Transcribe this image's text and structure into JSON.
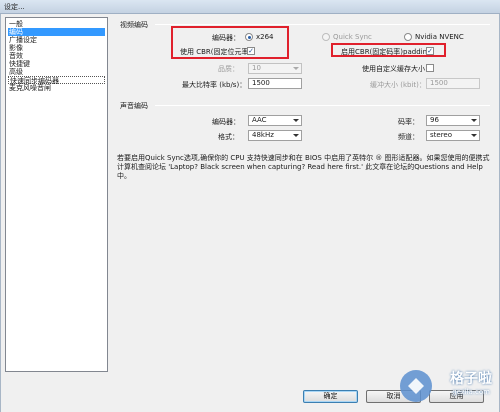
{
  "window": {
    "title": "设定..."
  },
  "sidebar": {
    "items": [
      {
        "label": "一般"
      },
      {
        "label": "编码"
      },
      {
        "label": "广播设定"
      },
      {
        "label": "影像"
      },
      {
        "label": "音效"
      },
      {
        "label": "快捷键"
      },
      {
        "label": "高级"
      },
      {
        "label": "快速同步编码器"
      },
      {
        "label": "麦克风噪音闸"
      }
    ]
  },
  "video": {
    "group_label": "视频编码",
    "encoder_label": "编码器：",
    "x264_label": "x264",
    "quicksync_label": "Quick Sync",
    "nvenc_label": "Nvidia NVENC",
    "cbr_label": "使用 CBR(固定位元率)",
    "cbr_padding_label": "启用CBR(固定码率)padding",
    "quality_label": "品质：",
    "quality_value": "10",
    "custom_buffer_label": "使用自定义缓存大小",
    "max_bitrate_label": "最大比特率 (kb/s)：",
    "max_bitrate_value": "1500",
    "buffer_size_label": "缓冲大小 (kbit)：",
    "buffer_size_value": "1500"
  },
  "audio": {
    "group_label": "声音编码",
    "codec_label": "编码器：",
    "codec_value": "AAC",
    "bitrate_label": "码率：",
    "bitrate_value": "96",
    "format_label": "格式：",
    "format_value": "48kHz",
    "channels_label": "频道：",
    "channels_value": "stereo"
  },
  "info": {
    "text": "若要启用Quick Sync选项,确保你的 CPU 支持快速同步和在 BIOS 中启用了英特尔 ® 图形适配器。如果您使用的便携式计算机查阅论坛 'Laptop? Black screen when capturing? Read here first.' 此文章在论坛的Questions and Help中。"
  },
  "buttons": {
    "ok_label": "确定",
    "cancel_label": "取消",
    "apply_label": "应用"
  },
  "watermark": {
    "text": "格子啦",
    "sub": "gezila.com"
  },
  "colors": {
    "highlight": "#e0202c",
    "selection": "#3399ff"
  }
}
